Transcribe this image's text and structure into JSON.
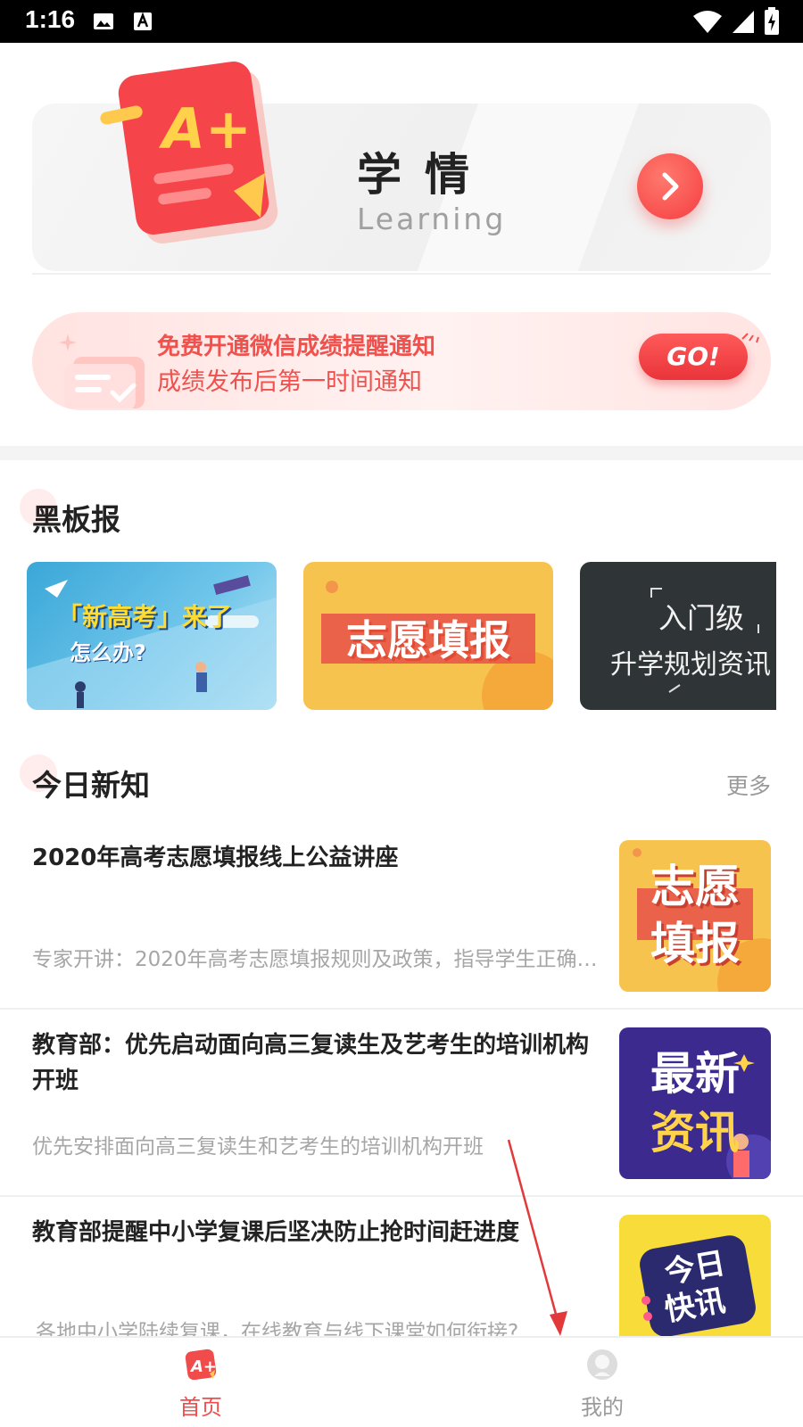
{
  "status_bar": {
    "time": "1:16"
  },
  "learning": {
    "title": "学情",
    "subtitle": "Learning",
    "badge_text": "A+"
  },
  "wechat_banner": {
    "line1": "免费开通微信成绩提醒通知",
    "line2": "成绩发布后第一时间通知",
    "go_label": "GO!"
  },
  "blackboard": {
    "title": "黑板报",
    "cards": [
      {
        "line1": "「新高考」来了",
        "line2": "怎么办?"
      },
      {
        "line1": "志愿填报"
      },
      {
        "line1": "入门级",
        "line2": "升学规划资讯"
      }
    ]
  },
  "today": {
    "title": "今日新知",
    "more": "更多",
    "news": [
      {
        "title": "2020年高考志愿填报线上公益讲座",
        "desc": "专家开讲：2020年高考志愿填报规则及政策，指导学生正确填报志愿",
        "thumb_line1": "志愿",
        "thumb_line2": "填报"
      },
      {
        "title": "教育部：优先启动面向高三复读生及艺考生的培训机构开班",
        "desc": "优先安排面向高三复读生和艺考生的培训机构开班",
        "thumb_line1": "最新",
        "thumb_line2": "资讯"
      },
      {
        "title": "教育部提醒中小学复课后坚决防止抢时间赶进度",
        "desc": "各地中小学陆续复课，在线教育与线下课堂如何衔接?",
        "thumb_line1": "今日",
        "thumb_line2": "快讯"
      }
    ]
  },
  "bottom_nav": {
    "home_label": "首页",
    "home_icon_text": "A+",
    "mine_label": "我的"
  },
  "colors": {
    "accent": "#f04c4c",
    "muted": "#9a9a9a"
  }
}
